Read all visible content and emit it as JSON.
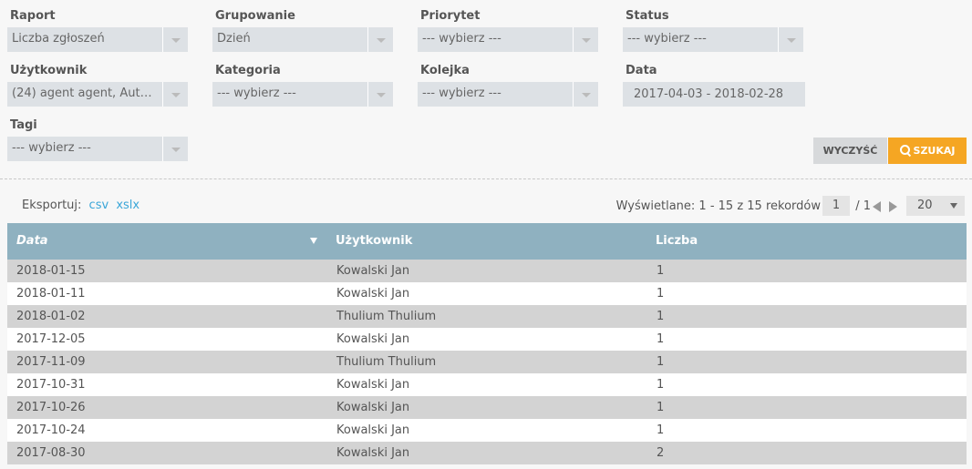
{
  "filters": {
    "raport": {
      "label": "Raport",
      "value": "Liczba zgłoszeń"
    },
    "grupowanie": {
      "label": "Grupowanie",
      "value": "Dzień"
    },
    "priorytet": {
      "label": "Priorytet",
      "value": "--- wybierz ---"
    },
    "status": {
      "label": "Status",
      "value": "--- wybierz ---"
    },
    "uzytkownik": {
      "label": "Użytkownik",
      "value": "(24) agent agent, Automa..."
    },
    "kategoria": {
      "label": "Kategoria",
      "value": "--- wybierz ---"
    },
    "kolejka": {
      "label": "Kolejka",
      "value": "--- wybierz ---"
    },
    "data": {
      "label": "Data",
      "value": "2017-04-03 - 2018-02-28"
    },
    "tagi": {
      "label": "Tagi",
      "value": "--- wybierz ---"
    }
  },
  "buttons": {
    "clear": "WYCZYŚĆ",
    "search": "SZUKAJ"
  },
  "export": {
    "label": "Eksportuj:",
    "csv": "csv",
    "xslx": "xslx"
  },
  "pager": {
    "info": "Wyświetlane: 1 - 15 z 15 rekordów",
    "page": "1",
    "total": "/ 1",
    "page_size": "20"
  },
  "table": {
    "headers": {
      "date": "Data",
      "user": "Użytkownik",
      "count": "Liczba"
    },
    "rows": [
      {
        "date": "2018-01-15",
        "user": "Kowalski Jan",
        "count": "1"
      },
      {
        "date": "2018-01-11",
        "user": "Kowalski Jan",
        "count": "1"
      },
      {
        "date": "2018-01-02",
        "user": "Thulium Thulium",
        "count": "1"
      },
      {
        "date": "2017-12-05",
        "user": "Kowalski Jan",
        "count": "1"
      },
      {
        "date": "2017-11-09",
        "user": "Thulium Thulium",
        "count": "1"
      },
      {
        "date": "2017-10-31",
        "user": "Kowalski Jan",
        "count": "1"
      },
      {
        "date": "2017-10-26",
        "user": "Kowalski Jan",
        "count": "1"
      },
      {
        "date": "2017-10-24",
        "user": "Kowalski Jan",
        "count": "1"
      },
      {
        "date": "2017-08-30",
        "user": "Kowalski Jan",
        "count": "2"
      }
    ]
  },
  "colors": {
    "accent": "#f5a623",
    "header": "#8fb1c0",
    "link": "#3aa6d8"
  }
}
